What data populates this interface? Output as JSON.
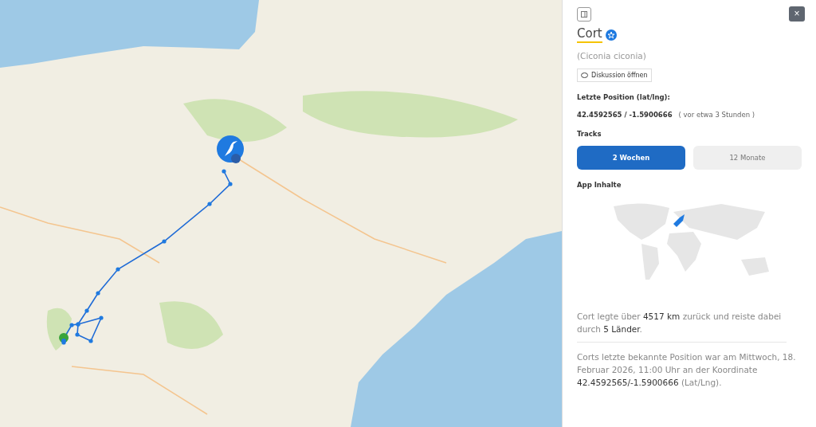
{
  "panel": {
    "close_button": "×",
    "title": "Cort",
    "subtitle": "(Ciconia ciconia)",
    "discussion_button": "Diskussion öffnen",
    "position_label": "Letzte Position (lat/lng):",
    "position_value": "42.4592565 / -1.5900666",
    "position_age": "( vor etwa 3 Stunden )",
    "tracks_label": "Tracks",
    "tracks": [
      {
        "label": "2 Wochen",
        "selected": true
      },
      {
        "label": "12 Monate",
        "selected": false
      }
    ],
    "app_label": "App Inhalte",
    "summary": "Cort legte über **4517 km** zurück und reiste dabei durch **5 Länder**.",
    "last_position": "Corts letzte bekannte Position war am Mittwoch, 18. Februar 2026, 11:00 Uhr an der Koordinate **42.4592565/-1.5900666** (Lat/Lng)."
  }
}
